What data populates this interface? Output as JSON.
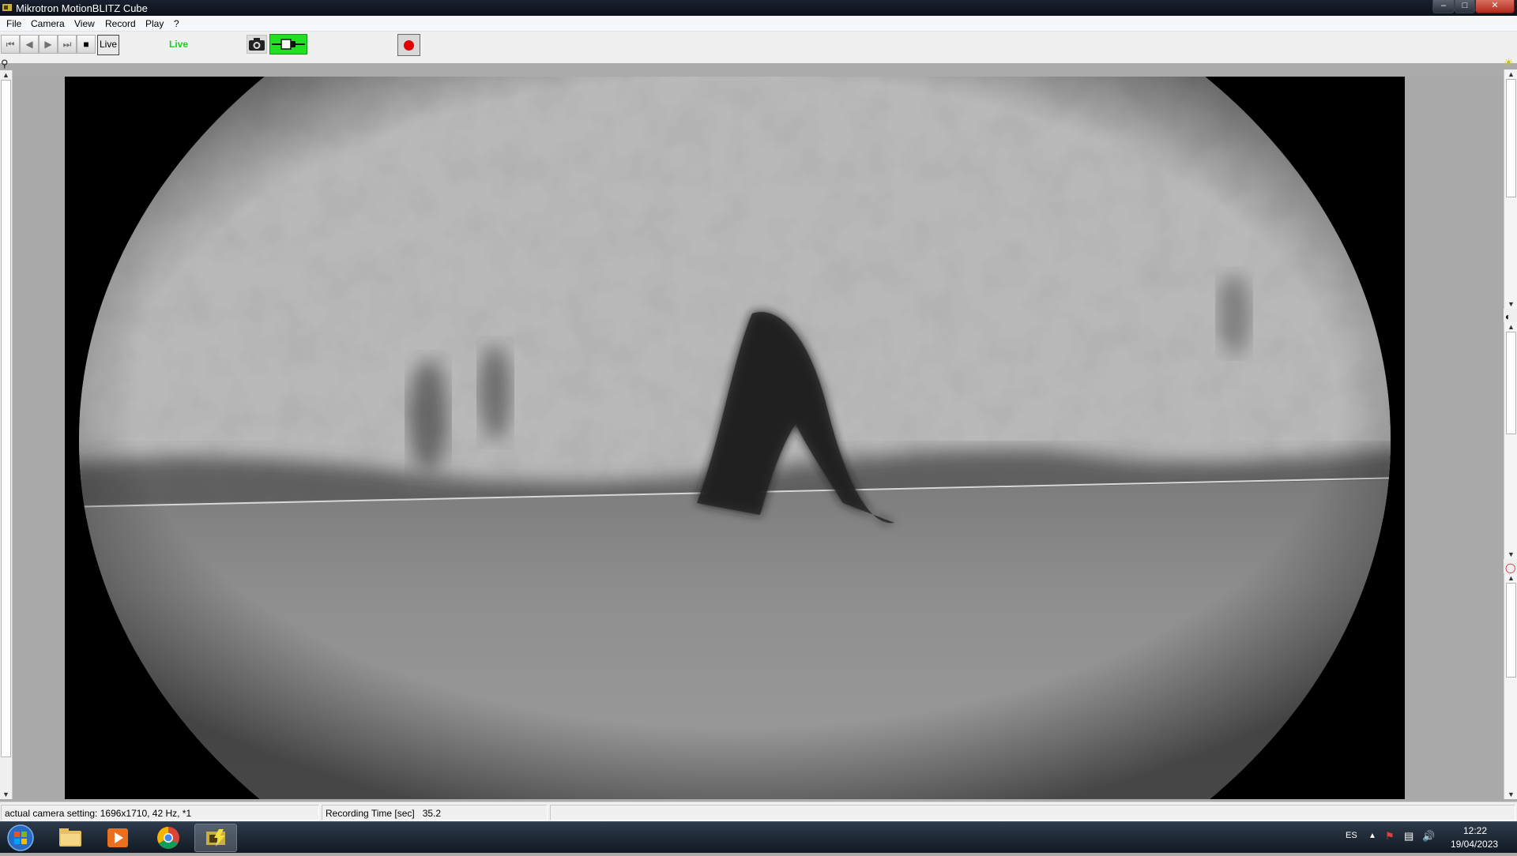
{
  "window": {
    "title": "Mikrotron MotionBLITZ Cube",
    "controls": {
      "minimize": "–",
      "maximize": "□",
      "close": "✕"
    }
  },
  "menu": [
    "File",
    "Camera",
    "View",
    "Record",
    "Play",
    "?"
  ],
  "toolbar": {
    "buttons": [
      {
        "icon": "skip-to-start-icon",
        "glyph": "⏮"
      },
      {
        "icon": "step-back-icon",
        "glyph": "◀"
      },
      {
        "icon": "play-icon",
        "glyph": "▶"
      },
      {
        "icon": "step-forward-icon",
        "glyph": "⏭"
      },
      {
        "icon": "stop-icon",
        "glyph": "■"
      }
    ],
    "live_button": "Live",
    "live_status": "Live",
    "live_status_color": "#22cc22",
    "trigger_color": "#22e022",
    "record_color": "#e00000"
  },
  "status": {
    "camera_setting": "actual camera setting:  1696x1710, 42 Hz, *1",
    "recording_time_label": "Recording Time [sec]",
    "recording_time_value": "35.2"
  },
  "taskbar": {
    "apps": [
      "windows-start",
      "file-explorer",
      "media-player",
      "chrome",
      "motionblitz"
    ],
    "language": "ES",
    "time": "12:22",
    "date": "19/04/2023"
  }
}
